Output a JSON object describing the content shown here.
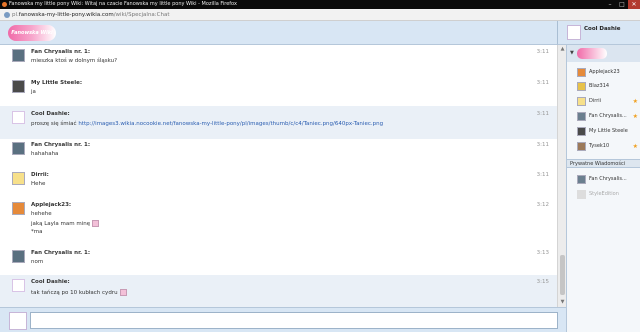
{
  "window": {
    "title": "Fanowska my little pony Wiki: Witaj na czacie Fanowska my little pony Wiki - Mozilla Firefox"
  },
  "url": {
    "prefix": "pl.",
    "host": "fanowska-my-little-pony.wikia.com",
    "path": "/wiki/Specjalna:Chat"
  },
  "logo": {
    "text": "Fanowska Wiki"
  },
  "header": {
    "me_name": "Cool Dashie"
  },
  "messages": [
    {
      "user": "Fan Chrysalis nr. 1:",
      "lines": [
        "mieszka ktoś w dolnym śląsku?"
      ],
      "time": "3:11"
    },
    {
      "user": "My Little Steele:",
      "lines": [
        "ja"
      ],
      "time": "3:11"
    },
    {
      "user": "Cool Dashie:",
      "prefix": "proszę się śmiać",
      "link": "http://images3.wikia.nocookie.net/fanowska-my-little-pony/pl/images/thumb/c/c4/Taniec.png/640px-Taniec.png",
      "time": "3:11"
    },
    {
      "user": "Fan Chrysalis nr. 1:",
      "lines": [
        "hahahaha"
      ],
      "time": "3:11"
    },
    {
      "user": "Dirrii:",
      "lines": [
        "Hehe"
      ],
      "time": "3:11"
    },
    {
      "user": "Applejack23:",
      "lines": [
        "hehehe",
        "jaką Layla mam minę",
        "*ma"
      ],
      "time": "3:12"
    },
    {
      "user": "Fan Chrysalis nr. 1:",
      "lines": [
        "nom"
      ],
      "time": "3:13"
    },
    {
      "user": "Cool Dashie:",
      "lines": [
        "tak tańczą po 10 kubłach cydru"
      ],
      "time": "3:15"
    }
  ],
  "sidebar": {
    "room_user": "Cool Dashie",
    "users": [
      {
        "name": "Applejack23",
        "star": false
      },
      {
        "name": "Blaz314",
        "star": false
      },
      {
        "name": "Dirrii",
        "star": true
      },
      {
        "name": "Fan Chrysalis...",
        "star": true
      },
      {
        "name": "My Little Steele",
        "star": false
      },
      {
        "name": "Tysek10",
        "star": true
      }
    ],
    "private_header": "Prywatne Wiadomości",
    "private": [
      {
        "name": "Fan Chrysalis...",
        "dim": false
      },
      {
        "name": "StyleEdition",
        "dim": true
      }
    ]
  },
  "input": {
    "value": ""
  },
  "colors": {
    "link": "#2a5db0",
    "header_bg": "#d8e6f4",
    "alt_row": "#eaf0f7",
    "star": "#f0a020"
  }
}
